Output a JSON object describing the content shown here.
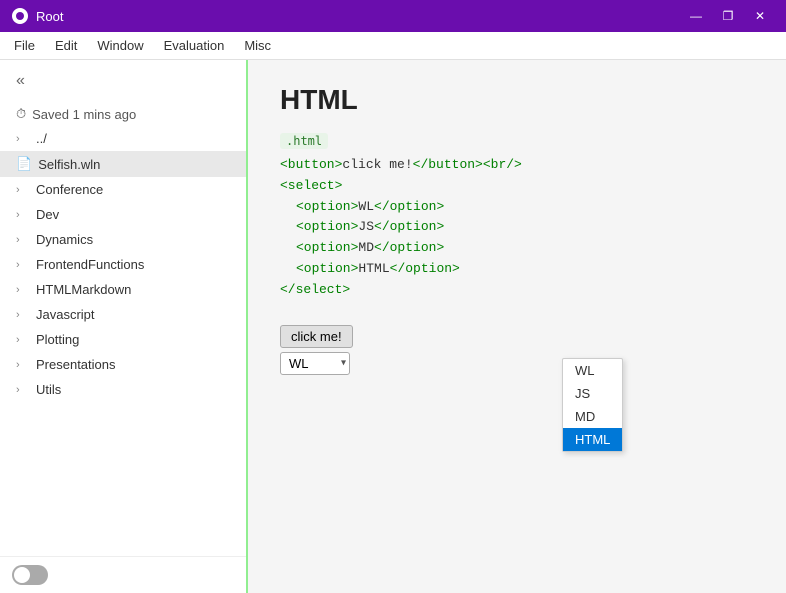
{
  "titlebar": {
    "title": "Root",
    "min_label": "—",
    "max_label": "❐",
    "close_label": "✕"
  },
  "menubar": {
    "items": [
      "File",
      "Edit",
      "Window",
      "Evaluation",
      "Misc"
    ]
  },
  "sidebar": {
    "collapse_icon": "«",
    "status_icon": "⏱",
    "status_text": "Saved 1 mins ago",
    "parent_label": "../",
    "active_file": "Selfish.wln",
    "items": [
      {
        "label": "Conference"
      },
      {
        "label": "Dev"
      },
      {
        "label": "Dynamics"
      },
      {
        "label": "FrontendFunctions"
      },
      {
        "label": "HTMLMarkdown"
      },
      {
        "label": "Javascript"
      },
      {
        "label": "Plotting"
      },
      {
        "label": "Presentations"
      },
      {
        "label": "Utils"
      }
    ],
    "theme_toggle_label": "theme-toggle"
  },
  "editor": {
    "title": "HTML",
    "badge": ".html",
    "code_lines": [
      {
        "type": "tag",
        "text": "<button>click me!</button><br/>"
      },
      {
        "type": "tag",
        "text": "<select>"
      },
      {
        "type": "indent_tag",
        "text": "<option>WL</option>"
      },
      {
        "type": "indent_tag",
        "text": "<option>JS</option>"
      },
      {
        "type": "indent_tag",
        "text": "<option>MD</option>"
      },
      {
        "type": "indent_tag",
        "text": "<option>HTML</option>"
      },
      {
        "type": "tag",
        "text": "</select>"
      }
    ]
  },
  "dropdown": {
    "options": [
      "WL",
      "JS",
      "MD",
      "HTML"
    ],
    "selected": "HTML",
    "current_value": "WL"
  },
  "preview": {
    "button_label": "click me!"
  }
}
